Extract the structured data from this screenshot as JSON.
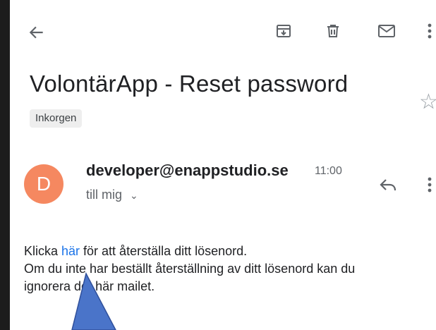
{
  "toolbar": {
    "back_icon": "arrow-back-icon",
    "archive_icon": "archive-icon",
    "delete_icon": "trash-icon",
    "mark_unread_icon": "envelope-icon",
    "more_icon": "more-vertical-icon"
  },
  "email": {
    "subject": "VolontärApp - Reset password",
    "label": "Inkorgen",
    "star_icon": "star-outline-icon",
    "sender": {
      "avatar_letter": "D",
      "avatar_color": "#f58860",
      "address": "developer@enappstudio.se",
      "time": "11:00",
      "recipient": "till mig",
      "reply_icon": "reply-icon",
      "more_icon": "more-vertical-icon"
    },
    "body": {
      "line1_prefix": "Klicka ",
      "line1_link": "här",
      "line1_suffix": " för att återställa ditt lösenord.",
      "line2": "Om du inte har beställt återställning av ditt lösenord kan du",
      "line3": "ignorera det här mailet."
    }
  },
  "colors": {
    "link": "#1a73e8",
    "annotation_arrow": "#4a74c9"
  }
}
